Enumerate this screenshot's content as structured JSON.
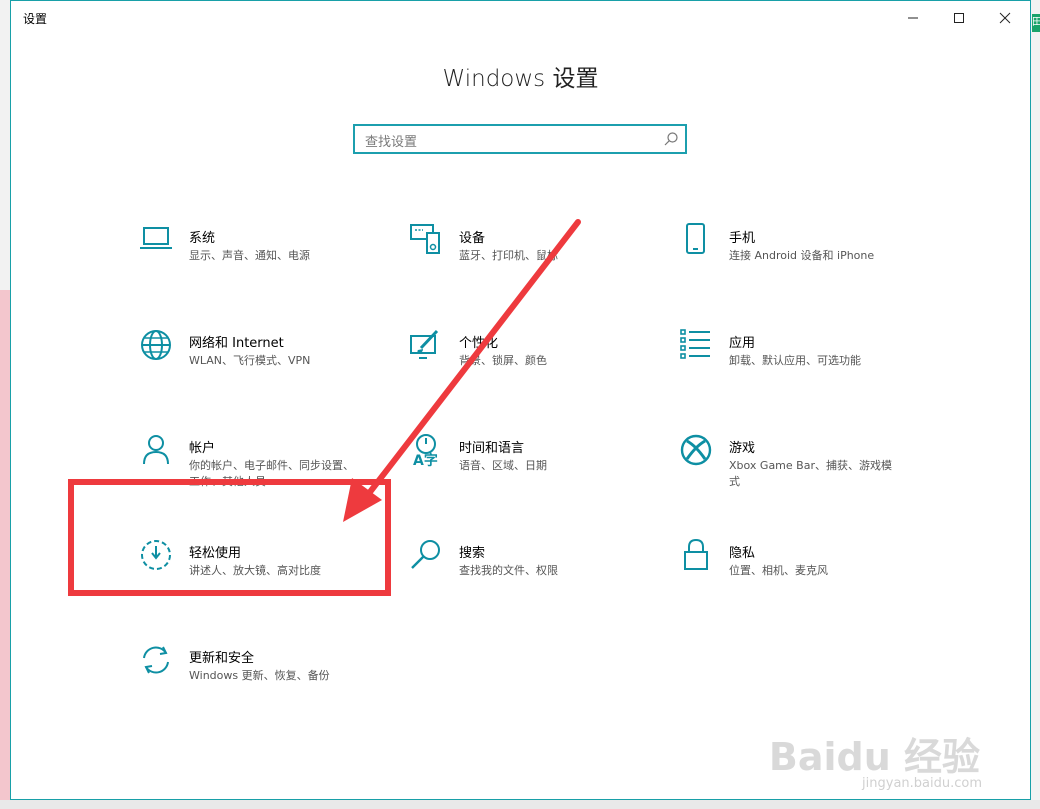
{
  "window": {
    "title": "设置",
    "page_title": "Windows 设置"
  },
  "search": {
    "placeholder": "查找设置"
  },
  "tiles": [
    {
      "name": "系统",
      "desc": "显示、声音、通知、电源",
      "icon": "laptop-icon"
    },
    {
      "name": "设备",
      "desc": "蓝牙、打印机、鼠标",
      "icon": "keyboard-device-icon"
    },
    {
      "name": "手机",
      "desc": "连接 Android 设备和 iPhone",
      "icon": "phone-icon"
    },
    {
      "name": "网络和 Internet",
      "desc": "WLAN、飞行模式、VPN",
      "icon": "globe-icon"
    },
    {
      "name": "个性化",
      "desc": "背景、锁屏、颜色",
      "icon": "paint-icon"
    },
    {
      "name": "应用",
      "desc": "卸载、默认应用、可选功能",
      "icon": "apps-list-icon"
    },
    {
      "name": "帐户",
      "desc": "你的帐户、电子邮件、同步设置、工作、其他人员",
      "icon": "person-icon"
    },
    {
      "name": "时间和语言",
      "desc": "语音、区域、日期",
      "icon": "time-language-icon"
    },
    {
      "name": "游戏",
      "desc": "Xbox Game Bar、捕获、游戏模式",
      "icon": "xbox-icon"
    },
    {
      "name": "轻松使用",
      "desc": "讲述人、放大镜、高对比度",
      "icon": "ease-of-access-icon"
    },
    {
      "name": "搜索",
      "desc": "查找我的文件、权限",
      "icon": "search-icon"
    },
    {
      "name": "隐私",
      "desc": "位置、相机、麦克风",
      "icon": "lock-icon"
    },
    {
      "name": "更新和安全",
      "desc": "Windows 更新、恢复、备份",
      "icon": "sync-icon"
    }
  ],
  "colors": {
    "accent": "#0e8fa3",
    "annotation": "#ee3a3e"
  },
  "watermark": {
    "brand": "Baidu 经验",
    "url": "jingyan.baidu.com"
  }
}
